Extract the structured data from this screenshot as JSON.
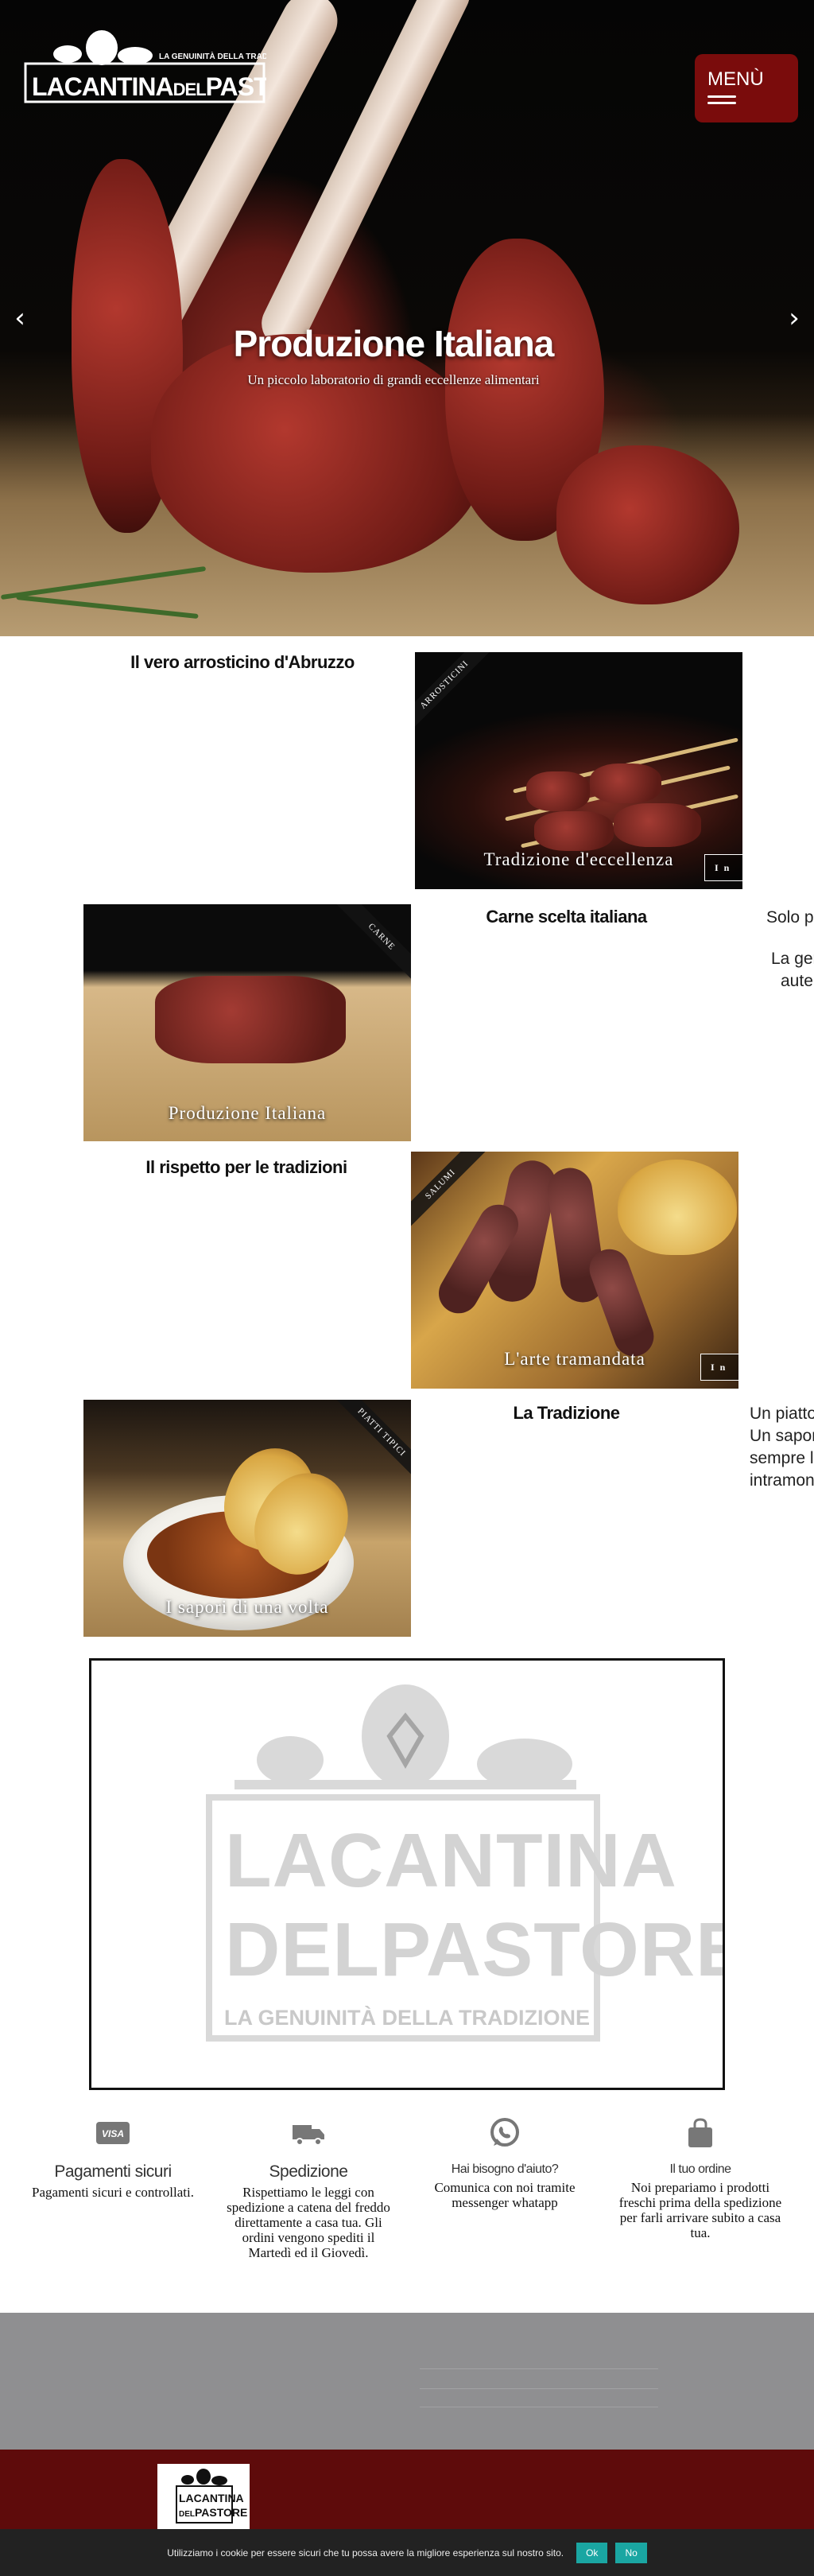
{
  "brand": {
    "logo_text_1": "LA",
    "logo_text_2": "CANTINA",
    "logo_text_3": "DEL",
    "logo_text_4": "PASTORE",
    "tagline": "LA GENUINITÀ DELLA TRADIZIONE"
  },
  "header": {
    "menu_label": "MENÙ"
  },
  "hero": {
    "title": "Produzione Italiana",
    "subtitle": "Un piccolo laboratorio di grandi eccellenze alimentari",
    "prev_icon": "chevron-left-icon",
    "next_icon": "chevron-right-icon"
  },
  "sections": [
    {
      "title": "Il vero arrosticino d'Abruzzo",
      "ribbon": "ARROSTICINI",
      "caption": "Tradizione d'eccellenza",
      "more": "I n"
    },
    {
      "title": "Carne scelta italiana",
      "ribbon": "CARNE",
      "caption": "Produzione Italiana",
      "side_1": "Solo pr",
      "side_2": "La gen",
      "side_3": "auten"
    },
    {
      "title": "Il rispetto per le tradizioni",
      "ribbon": "SALUMI",
      "caption": "L'arte tramandata",
      "more": "I n"
    },
    {
      "title": "La Tradizione",
      "ribbon": "PIATTI TIPICI",
      "caption": "I sapori di una volta",
      "side_1": "Un piatto",
      "side_2": "Un sapore",
      "side_3": "sempre la",
      "side_4": "intramont"
    }
  ],
  "features": [
    {
      "icon": "visa-card-icon",
      "title": "Pagamenti sicuri",
      "text": "Pagamenti sicuri e controllati."
    },
    {
      "icon": "truck-icon",
      "title": "Spedizione",
      "text": "Rispettiamo le leggi con spedizione a catena del freddo direttamente a casa tua. Gli ordini vengono spediti il Martedì ed il Giovedì."
    },
    {
      "icon": "whatsapp-icon",
      "title": "Hai bisogno d'aiuto?",
      "text": "Comunica con noi tramite messenger whatapp"
    },
    {
      "icon": "shopping-bag-icon",
      "title": "Il tuo ordine",
      "text": "Noi prepariamo i prodotti freschi prima della spedizione per farli arrivare subito a casa tua."
    }
  ],
  "cookie": {
    "text": "Utilizziamo i cookie per essere sicuri che tu possa avere la migliore esperienza sul nostro sito.",
    "ok": "Ok",
    "no": "No"
  },
  "colors": {
    "accent": "#7a0c0c",
    "footer": "#5e0b0b",
    "cookie_button": "#1aa6a2"
  }
}
